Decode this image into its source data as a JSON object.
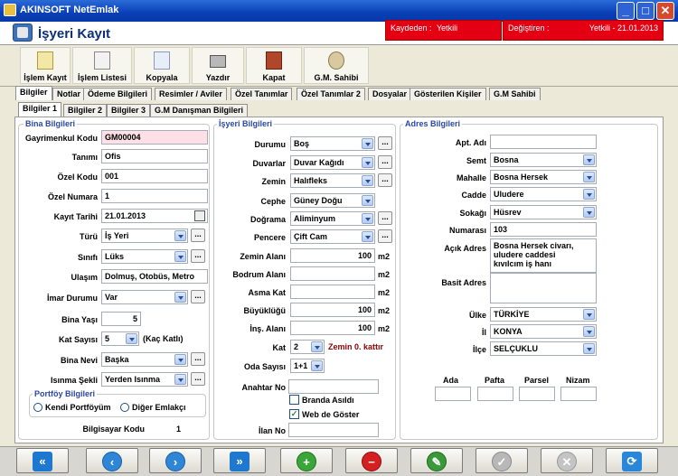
{
  "window": {
    "title": "AKINSOFT NetEmlak",
    "controls": [
      "_",
      "□",
      "✕"
    ]
  },
  "header": {
    "title": "İşyeri Kayıt",
    "saved_by_label": "Kaydeden :",
    "saved_by_value": "Yetkili",
    "changed_by_label": "Değiştiren :",
    "changed_by_value": "Yetkili - 21.01.2013"
  },
  "toolbar": [
    {
      "label": "İşlem Kayıt",
      "icon": "list-icon"
    },
    {
      "label": "İşlem Listesi",
      "icon": "list-edit-icon"
    },
    {
      "label": "Kopyala",
      "icon": "copy-icon"
    },
    {
      "label": "Yazdır",
      "icon": "printer-icon"
    },
    {
      "label": "Kapat",
      "icon": "door-exit-icon"
    },
    {
      "label": "G.M. Sahibi",
      "icon": "owner-icon"
    }
  ],
  "tabs": [
    "Bilgiler",
    "Notlar",
    "Ödeme Bilgileri",
    "Resimler / Aviler",
    "Özel Tanımlar",
    "Özel Tanımlar 2",
    "Dosyalar",
    "Gösterilen Kişiler",
    "G.M Sahibi"
  ],
  "subtabs": [
    "Bilgiler 1",
    "Bilgiler 2",
    "Bilgiler 3",
    "G.M Danışman Bilgileri"
  ],
  "bina": {
    "title": "Bina Bilgileri",
    "gayrimenkul_kodu": {
      "label": "Gayrimenkul Kodu",
      "value": "GM00004"
    },
    "tanimi": {
      "label": "Tanımı",
      "value": "Ofis"
    },
    "ozel_kodu": {
      "label": "Özel Kodu",
      "value": "001"
    },
    "ozel_numara": {
      "label": "Özel Numara",
      "value": "1"
    },
    "kayit_tarihi": {
      "label": "Kayıt Tarihi",
      "value": "21.01.2013"
    },
    "turu": {
      "label": "Türü",
      "value": "İş Yeri"
    },
    "sinifi": {
      "label": "Sınıfı",
      "value": "Lüks"
    },
    "ulasim": {
      "label": "Ulaşım",
      "value": "Dolmuş, Otobüs, Metro"
    },
    "imar": {
      "label": "İmar Durumu",
      "value": "Var"
    },
    "bina_yasi": {
      "label": "Bina Yaşı",
      "value": "5"
    },
    "kat_sayisi": {
      "label": "Kat Sayısı",
      "value": "5",
      "suffix": "(Kaç Katlı)"
    },
    "bina_nevi": {
      "label": "Bina Nevi",
      "value": "Başka"
    },
    "isinma": {
      "label": "Isınma Şekli",
      "value": "Yerden Isınma"
    },
    "portfoy_title": "Portföy Bilgileri",
    "portfoy_opt1": "Kendi Portföyüm",
    "portfoy_opt2": "Diğer Emlakçı",
    "bilgisayar_kodu": {
      "label": "Bilgisayar Kodu",
      "value": "1"
    }
  },
  "isyeri": {
    "title": "İşyeri Bilgileri",
    "durumu": {
      "label": "Durumu",
      "value": "Boş"
    },
    "duvarlar": {
      "label": "Duvarlar",
      "value": "Duvar Kağıdı"
    },
    "zemin": {
      "label": "Zemin",
      "value": "Halıfleks"
    },
    "cephe": {
      "label": "Cephe",
      "value": "Güney Doğu"
    },
    "dograma": {
      "label": "Doğrama",
      "value": "Aliminyum"
    },
    "pencere": {
      "label": "Pencere",
      "value": "Çift Cam"
    },
    "zemin_alani": {
      "label": "Zemin Alanı",
      "value": "100",
      "unit": "m2"
    },
    "bodrum_alani": {
      "label": "Bodrum Alanı",
      "value": "",
      "unit": "m2"
    },
    "asma_kat": {
      "label": "Asma Kat",
      "value": "",
      "unit": "m2"
    },
    "buyuklugu": {
      "label": "Büyüklüğü",
      "value": "100",
      "unit": "m2"
    },
    "ins_alani": {
      "label": "İnş. Alanı",
      "value": "100",
      "unit": "m2"
    },
    "kat": {
      "label": "Kat",
      "value": "2",
      "note": "Zemin 0. kattır"
    },
    "oda_sayisi": {
      "label": "Oda Sayısı",
      "value": "1+1"
    },
    "anahtar_no": {
      "label": "Anahtar No",
      "value": ""
    },
    "branda": {
      "label": "Branda Asıldı",
      "checked": false
    },
    "web": {
      "label": "Web de Göster",
      "checked": true
    },
    "ilan_no": {
      "label": "İlan No",
      "value": ""
    }
  },
  "adres": {
    "title": "Adres Bilgileri",
    "apt_adi": {
      "label": "Apt. Adı",
      "value": ""
    },
    "semt": {
      "label": "Semt",
      "value": "Bosna"
    },
    "mahalle": {
      "label": "Mahalle",
      "value": "Bosna Hersek"
    },
    "cadde": {
      "label": "Cadde",
      "value": "Uludere"
    },
    "sokagi": {
      "label": "Sokağı",
      "value": "Hüsrev"
    },
    "numarasi": {
      "label": "Numarası",
      "value": "103"
    },
    "acik_adres": {
      "label": "Açık Adres",
      "value": "Bosna Hersek civarı, uludere caddesi kıvılcım iş hanı"
    },
    "basit_adres": {
      "label": "Basit Adres",
      "value": ""
    },
    "ulke": {
      "label": "Ülke",
      "value": "TÜRKİYE"
    },
    "il": {
      "label": "İl",
      "value": "KONYA"
    },
    "ilce": {
      "label": "İlçe",
      "value": "SELÇUKLU"
    },
    "ada_label": "Ada",
    "pafta_label": "Pafta",
    "parsel_label": "Parsel",
    "nizam_label": "Nizam"
  },
  "nav_buttons": [
    {
      "name": "first-button",
      "icon": "double-left-icon"
    },
    {
      "name": "prev-button",
      "icon": "left-icon"
    },
    {
      "name": "next-button",
      "icon": "right-icon"
    },
    {
      "name": "last-button",
      "icon": "double-right-icon"
    },
    {
      "name": "add-button",
      "icon": "plus-icon"
    },
    {
      "name": "delete-button",
      "icon": "minus-icon"
    },
    {
      "name": "edit-button",
      "icon": "pencil-icon"
    },
    {
      "name": "save-button",
      "icon": "check-icon"
    },
    {
      "name": "cancel-button",
      "icon": "x-icon"
    },
    {
      "name": "refresh-button",
      "icon": "refresh-icon"
    }
  ]
}
